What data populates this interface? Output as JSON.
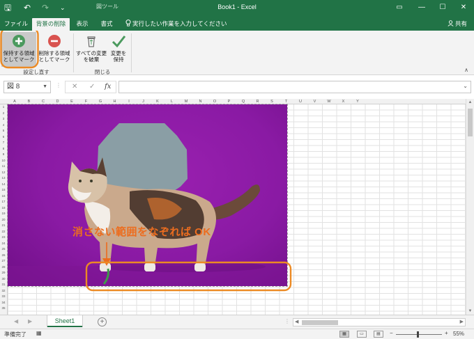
{
  "titlebar": {
    "context_label": "図ツール",
    "document_title": "Book1  -  Excel",
    "quick_access": {
      "save": "🖫",
      "undo": "↶",
      "redo": "↷",
      "customize": "⌄"
    },
    "window": {
      "ribbon_options": "▭",
      "minimize": "—",
      "maximize": "☐",
      "close": "✕"
    }
  },
  "tabs": {
    "file": "ファイル",
    "remove_background": "背景の削除",
    "view": "表示",
    "format": "書式",
    "tell_me": "実行したい作業を入力してください",
    "share": "共有"
  },
  "ribbon": {
    "mark_keep": {
      "line1": "保持する領域",
      "line2": "としてマーク"
    },
    "mark_remove": {
      "line1": "削除する領域",
      "line2": "としてマーク"
    },
    "discard_all": {
      "line1": "すべての変更",
      "line2": "を破棄"
    },
    "keep_changes": {
      "line1": "変更を",
      "line2": "保持"
    },
    "group_refine": "設定し直す",
    "group_close": "閉じる",
    "collapse": "∧"
  },
  "formula_bar": {
    "name_box": "図 8",
    "cancel": "✕",
    "enter": "✓",
    "function": "fx",
    "value": ""
  },
  "grid": {
    "columns": [
      "A",
      "B",
      "C",
      "D",
      "E",
      "F",
      "G",
      "H",
      "I",
      "J",
      "K",
      "L",
      "M",
      "N",
      "O",
      "P",
      "Q",
      "R",
      "S",
      "T",
      "U",
      "V",
      "W",
      "X",
      "Y"
    ],
    "rows": [
      "1",
      "2",
      "3",
      "4",
      "5",
      "6",
      "7",
      "8",
      "9",
      "10",
      "11",
      "12",
      "13",
      "14",
      "15",
      "16",
      "17",
      "18",
      "19",
      "20",
      "21",
      "22",
      "23",
      "24",
      "25",
      "26",
      "27",
      "28",
      "29",
      "30",
      "31",
      "32",
      "33",
      "34",
      "35"
    ]
  },
  "annotation": {
    "text": "消さない範囲をなぞれば OK"
  },
  "sheets": {
    "tabs": [
      "Sheet1"
    ],
    "add": "+",
    "nav_prev": "◀",
    "nav_next": "▶"
  },
  "status": {
    "ready": "準備完了",
    "zoom": "55%",
    "zoom_minus": "−",
    "zoom_plus": "+"
  },
  "colors": {
    "excel_green": "#217346",
    "annotation_orange": "#ec6d1f",
    "photo_purple": "#8a1aa4"
  }
}
